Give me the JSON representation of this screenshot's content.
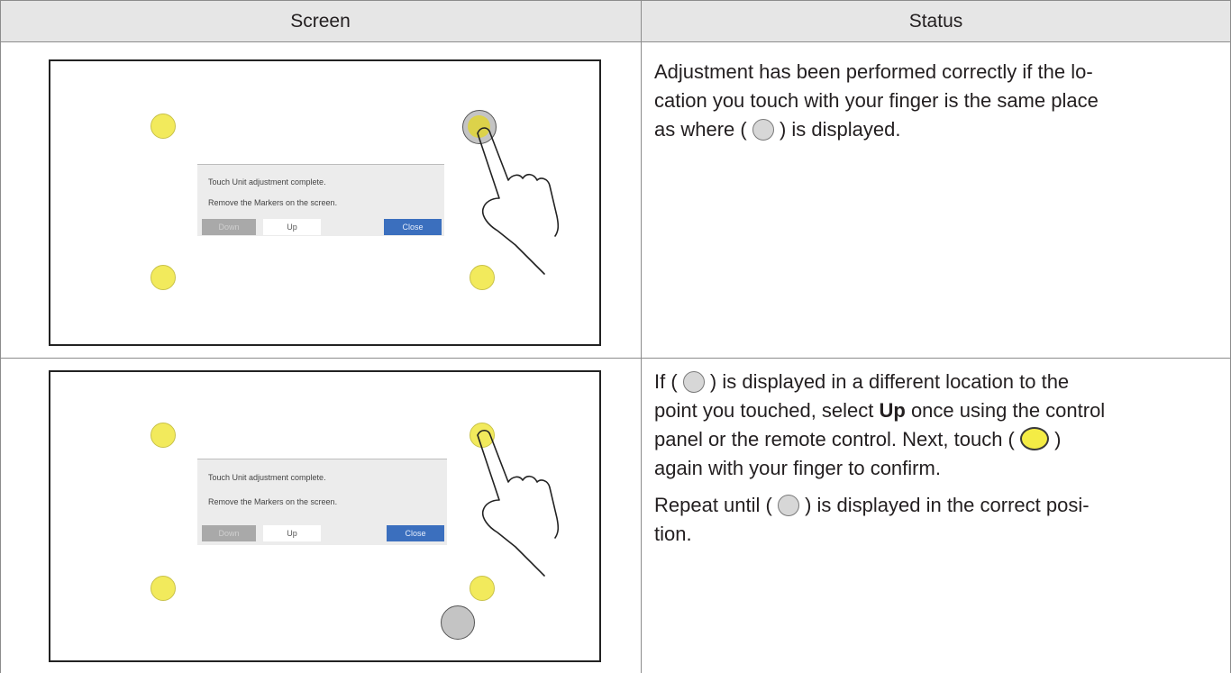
{
  "table": {
    "headers": [
      "Screen",
      "Status"
    ]
  },
  "dialog": {
    "line1": "Touch Unit adjustment complete.",
    "line2": "Remove the Markers on the screen.",
    "btn_down": "Down",
    "btn_up": "Up",
    "btn_close": "Close"
  },
  "row1": {
    "status_text": {
      "before_circle": "Adjustment has been performed correctly if the lo-\ncation you touch with your finger is the same place\nas where ( ",
      "after_circle": " ) is displayed."
    }
  },
  "row2": {
    "p1_a": "If ( ",
    "p1_b": " ) is displayed in a different location to the\npoint you touched, select ",
    "p1_bold": "Up",
    "p1_c": " once using the control\npanel or the remote control. Next, touch ( ",
    "p1_d": " )\nagain with your finger to confirm.",
    "p2_a": "Repeat until ( ",
    "p2_b": " ) is displayed in the correct posi-\ntion."
  },
  "colors": {
    "marker_yellow": "#f2ea5c",
    "pointer_gray": "#c4c4c4",
    "close_blue": "#3b6fbe",
    "header_bg": "#e6e6e6"
  }
}
